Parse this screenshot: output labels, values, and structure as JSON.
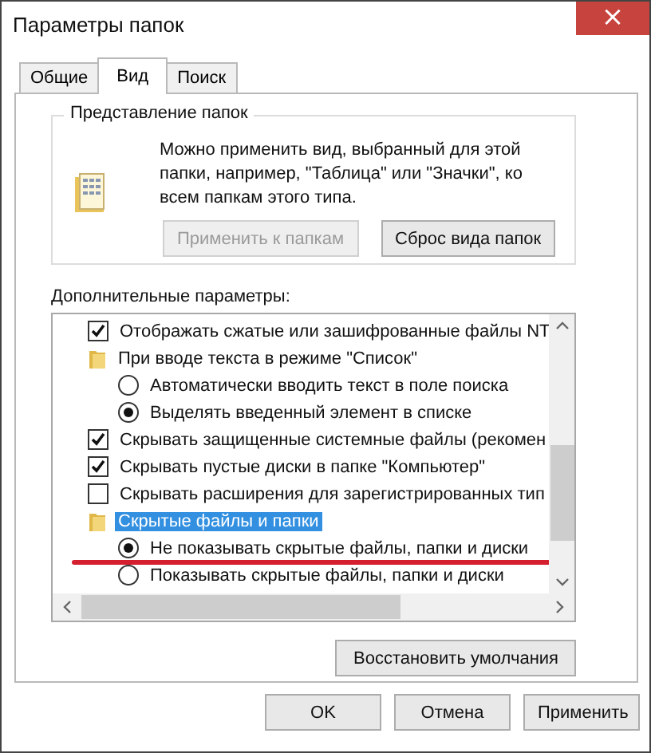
{
  "window": {
    "title": "Параметры папок",
    "close": "×"
  },
  "tabs": [
    {
      "label": "Общие",
      "selected": false
    },
    {
      "label": "Вид",
      "selected": true
    },
    {
      "label": "Поиск",
      "selected": false
    }
  ],
  "folder_views": {
    "title": "Представление папок",
    "description": "Можно применить вид, выбранный для этой папки, например, \"Таблица\" или \"Значки\", ко всем папкам этого типа.",
    "buttons": [
      {
        "label": "Применить к папкам",
        "disabled": true
      },
      {
        "label": "Сброс вида папок",
        "disabled": false
      }
    ]
  },
  "advanced": {
    "label": "Дополнительные параметры:",
    "tree": [
      {
        "kind": "checkbox",
        "label": "Отображать сжатые или зашифрованные файлы NT",
        "checked": true
      },
      {
        "kind": "folder",
        "label": "При вводе текста в режиме \"Список\"",
        "selected": false,
        "children": [
          {
            "kind": "radio",
            "label": "Автоматически вводить текст в поле поиска",
            "selected": false,
            "underlined": false
          },
          {
            "kind": "radio",
            "label": "Выделять введенный элемент в списке",
            "selected": true,
            "underlined": false
          }
        ]
      },
      {
        "kind": "checkbox",
        "label": "Скрывать защищенные системные файлы (рекомен",
        "checked": true
      },
      {
        "kind": "checkbox",
        "label": "Скрывать пустые диски в папке \"Компьютер\"",
        "checked": true
      },
      {
        "kind": "checkbox",
        "label": "Скрывать расширения для зарегистрированных тип",
        "checked": false
      },
      {
        "kind": "folder",
        "label": "Скрытые файлы и папки",
        "selected": true,
        "children": [
          {
            "kind": "radio",
            "label": "Не показывать скрытые файлы, папки и диски",
            "selected": true,
            "underlined": true
          },
          {
            "kind": "radio",
            "label": "Показывать скрытые файлы, папки и диски",
            "selected": false,
            "underlined": false
          }
        ]
      }
    ],
    "restore_button": "Восстановить умолчания"
  },
  "buttons": [
    "OK",
    "Отмена",
    "Применить"
  ]
}
